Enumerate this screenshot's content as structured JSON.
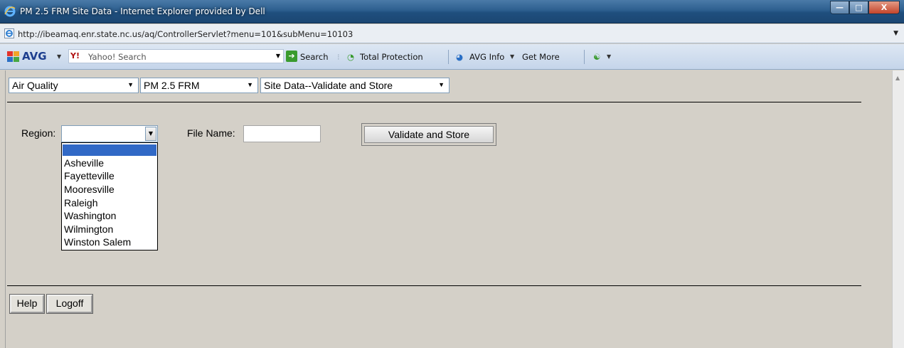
{
  "window": {
    "title": "PM 2.5 FRM Site Data - Internet Explorer provided by Dell",
    "url": "http://ibeamaq.enr.state.nc.us/aq/ControllerServlet?menu=101&subMenu=10103",
    "controls": {
      "min": "—",
      "max": "□",
      "close": "X"
    }
  },
  "toolbar": {
    "avg_label": "AVG",
    "yahoo_logo": "Y!",
    "search_placeholder": "Yahoo! Search",
    "search_button": "Search",
    "total_protection": "Total Protection",
    "avg_info": "AVG Info",
    "get_more": "Get More"
  },
  "nav": {
    "menu1": "Air Quality",
    "menu2": "PM 2.5 FRM",
    "menu3": "Site Data--Validate and Store"
  },
  "form": {
    "region_label": "Region:",
    "region_value": "",
    "region_options": [
      "Asheville",
      "Fayetteville",
      "Mooresville",
      "Raleigh",
      "Washington",
      "Wilmington",
      "Winston Salem"
    ],
    "file_name_label": "File Name:",
    "file_name_value": "",
    "validate_button": "Validate and Store"
  },
  "footer": {
    "help": "Help",
    "logoff": "Logoff"
  }
}
